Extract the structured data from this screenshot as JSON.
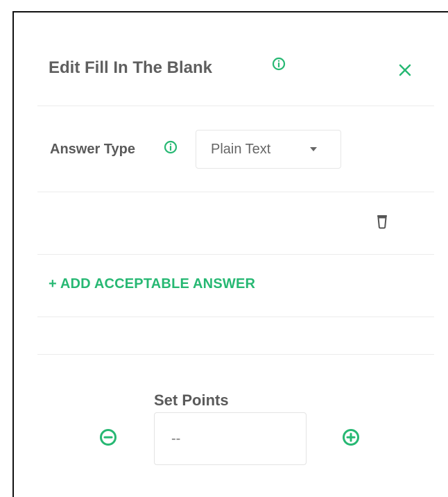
{
  "dialog": {
    "title": "Edit Fill In The Blank",
    "icons": {
      "title_info": "info-icon",
      "close": "close-icon"
    }
  },
  "answer_type": {
    "label": "Answer Type",
    "selected": "Plain Text",
    "info_icon": "info-icon"
  },
  "acceptable_answers": {
    "delete_icon": "trash-icon",
    "add_label": "+ ADD ACCEPTABLE ANSWER"
  },
  "points": {
    "label": "Set Points",
    "value": "--",
    "decrement_icon": "minus-circle-icon",
    "increment_icon": "plus-circle-icon"
  },
  "colors": {
    "accent": "#27b873",
    "text": "#5a5a5a"
  }
}
